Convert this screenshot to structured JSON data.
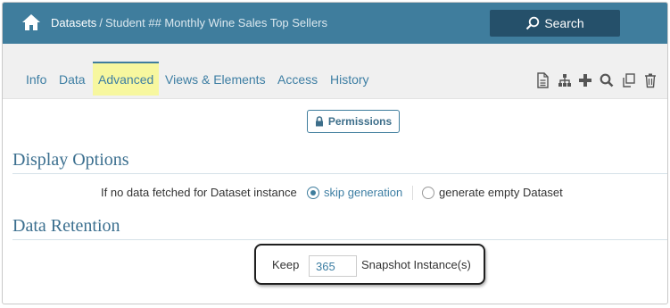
{
  "header": {
    "breadcrumb_link": "Datasets",
    "breadcrumb_sep": "/",
    "breadcrumb_current": "Student ## Monthly Wine Sales Top Sellers",
    "search_label": "Search",
    "color": "#3f7d9d"
  },
  "tabs": {
    "info": "Info",
    "data": "Data",
    "advanced": "Advanced",
    "views": "Views & Elements",
    "access": "Access",
    "history": "History",
    "active": "Advanced"
  },
  "toolbar_icons": [
    "document-icon",
    "hierarchy-icon",
    "plus-icon",
    "search-icon",
    "copy-icon",
    "trash-icon"
  ],
  "permissions_button": "Permissions",
  "display_options": {
    "title": "Display Options",
    "label": "If no data fetched for Dataset instance",
    "options": [
      "skip generation",
      "generate empty Dataset"
    ],
    "selected": "skip generation"
  },
  "data_retention": {
    "title": "Data Retention",
    "keep_label": "Keep",
    "keep_value": "365",
    "suffix": "Snapshot Instance(s)"
  }
}
